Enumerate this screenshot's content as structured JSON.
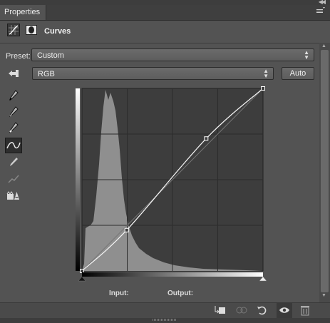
{
  "panel": {
    "tab_label": "Properties"
  },
  "header": {
    "title": "Curves",
    "adjustment_icon": "curves-adjustment-icon",
    "mask_icon": "layer-mask-icon"
  },
  "preset": {
    "label": "Preset:",
    "value": "Custom"
  },
  "channel": {
    "value": "RGB",
    "auto_label": "Auto"
  },
  "tools": [
    "on-image-adjust-icon",
    "black-point-eyedropper-icon",
    "gray-point-eyedropper-icon",
    "white-point-eyedropper-icon",
    "curve-point-tool-icon",
    "pencil-draw-icon",
    "smooth-curve-icon",
    "clipping-warning-icon"
  ],
  "curve": {
    "points": [
      [
        0,
        0
      ],
      [
        63,
        57
      ],
      [
        175,
        185
      ],
      [
        255,
        255
      ]
    ],
    "grid_divisions": 4
  },
  "io": {
    "input_label": "Input:",
    "output_label": "Output:"
  },
  "footer_icons": [
    "clip-to-layer-icon",
    "view-previous-state-icon",
    "reset-icon",
    "visibility-eye-icon",
    "delete-trash-icon"
  ],
  "colors": {
    "panel_bg": "#535353",
    "graph_bg": "#3d3d3d",
    "histogram": "#8f8f8f"
  }
}
